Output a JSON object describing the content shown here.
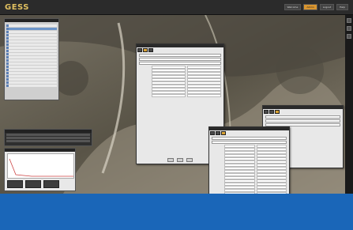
{
  "app": {
    "logo": "GESS"
  },
  "topbar": {
    "items": [
      {
        "label": "Welcome"
      },
      {
        "label": "Admin"
      },
      {
        "label": "Logout"
      },
      {
        "label": "Help"
      }
    ]
  },
  "layers_panel": {
    "title": ""
  },
  "status_panel": {
    "title": ""
  },
  "graph_panel": {
    "title": "",
    "buttons": [
      {
        "label": ""
      },
      {
        "label": ""
      },
      {
        "label": ""
      }
    ]
  },
  "dialogs": [
    {
      "title": "",
      "tabs": [
        {
          "label": ""
        },
        {
          "label": ""
        },
        {
          "label": ""
        }
      ],
      "footer": [
        {
          "label": ""
        },
        {
          "label": ""
        },
        {
          "label": ""
        }
      ]
    },
    {
      "title": "",
      "tabs": [
        {
          "label": ""
        },
        {
          "label": ""
        },
        {
          "label": ""
        }
      ],
      "footer": [
        {
          "label": ""
        },
        {
          "label": ""
        },
        {
          "label": ""
        }
      ]
    },
    {
      "title": "",
      "tabs": [
        {
          "label": ""
        },
        {
          "label": ""
        },
        {
          "label": ""
        }
      ],
      "footer": []
    }
  ],
  "colors": {
    "accent": "#d9a233",
    "bg": "#1a66b8",
    "topbar": "#2b2b2b"
  }
}
